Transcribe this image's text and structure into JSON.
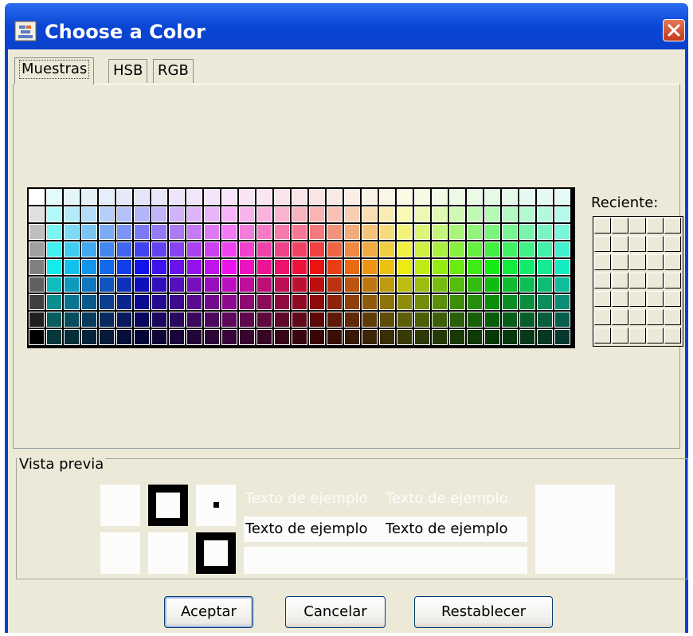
{
  "window": {
    "title": "Choose a Color",
    "icon": "java-cup-icon",
    "close_icon": "close-icon",
    "close_color": "#d44a26"
  },
  "tabs": [
    {
      "label": "Muestras",
      "selected": true
    },
    {
      "label": "HSB",
      "selected": false
    },
    {
      "label": "RGB",
      "selected": false
    }
  ],
  "swatches": {
    "columns": 31,
    "rows": 9
  },
  "recent": {
    "label": "Reciente:",
    "columns": 5,
    "rows": 7
  },
  "preview": {
    "legend": "Vista previa",
    "sample_text": "Texto de ejemplo"
  },
  "buttons": {
    "ok": "Aceptar",
    "cancel": "Cancelar",
    "reset": "Restablecer"
  },
  "colors": {
    "title_bar": "#0a46d4",
    "dialog_bg": "#ece9d8",
    "selected_color": "#ffffff"
  }
}
